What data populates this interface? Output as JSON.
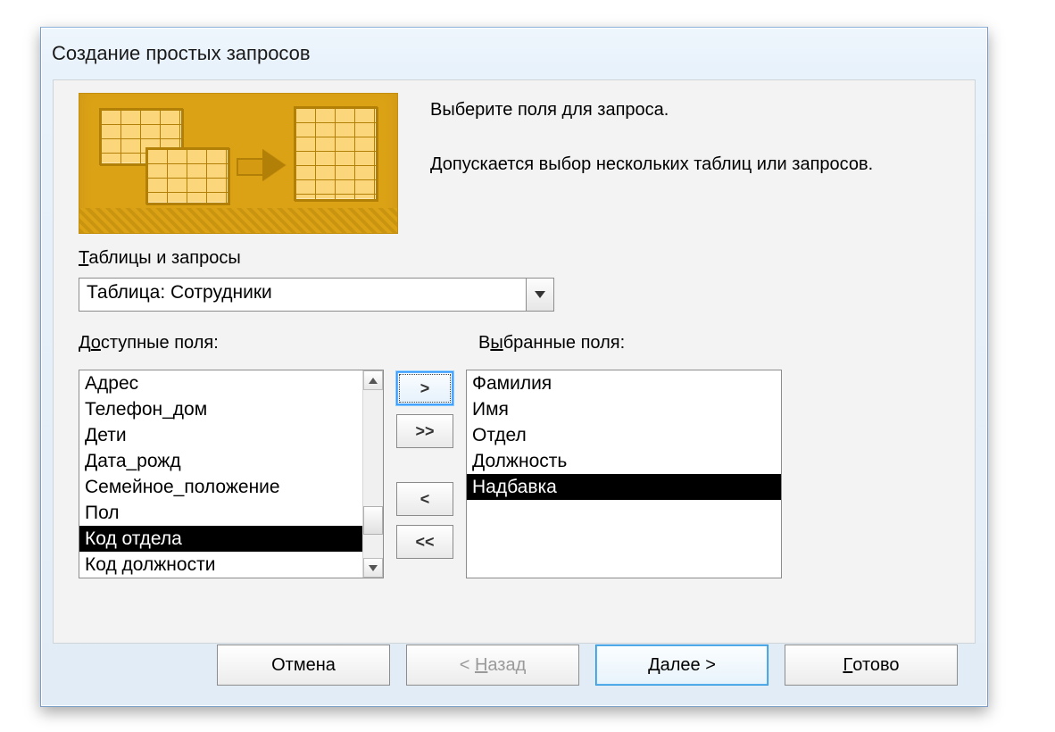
{
  "title": "Создание простых запросов",
  "intro_line1": "Выберите поля для запроса.",
  "intro_line2": "Допускается выбор нескольких таблиц или запросов.",
  "tables_label_pre": "Т",
  "tables_label_rest": "аблицы и запросы",
  "combo_value": "Таблица: Сотрудники",
  "available_label_pre": "Д",
  "available_label_mid": "о",
  "available_label_rest": "ступные поля:",
  "selected_label_pre": "В",
  "selected_label_mid": "ы",
  "selected_label_rest": "бранные поля:",
  "available_fields": {
    "0": "Адрес",
    "1": "Телефон_дом",
    "2": "Дети",
    "3": "Дата_рожд",
    "4": "Семейное_положение",
    "5": "Пол",
    "6": "Код отдела",
    "7": "Код должности"
  },
  "available_selected_index": 6,
  "selected_fields": {
    "0": "Фамилия",
    "1": "Имя",
    "2": "Отдел",
    "3": "Должность",
    "4": "Надбавка"
  },
  "selected_selected_index": 4,
  "move": {
    "add_one": ">",
    "add_all": ">>",
    "remove_one": "<",
    "remove_all": "<<"
  },
  "buttons": {
    "cancel": "Отмена",
    "back_lt": "< ",
    "back_u": "Н",
    "back_rest": "азад",
    "next_u": "Д",
    "next_rest": "алее >",
    "finish_u": "Г",
    "finish_rest": "отово"
  }
}
